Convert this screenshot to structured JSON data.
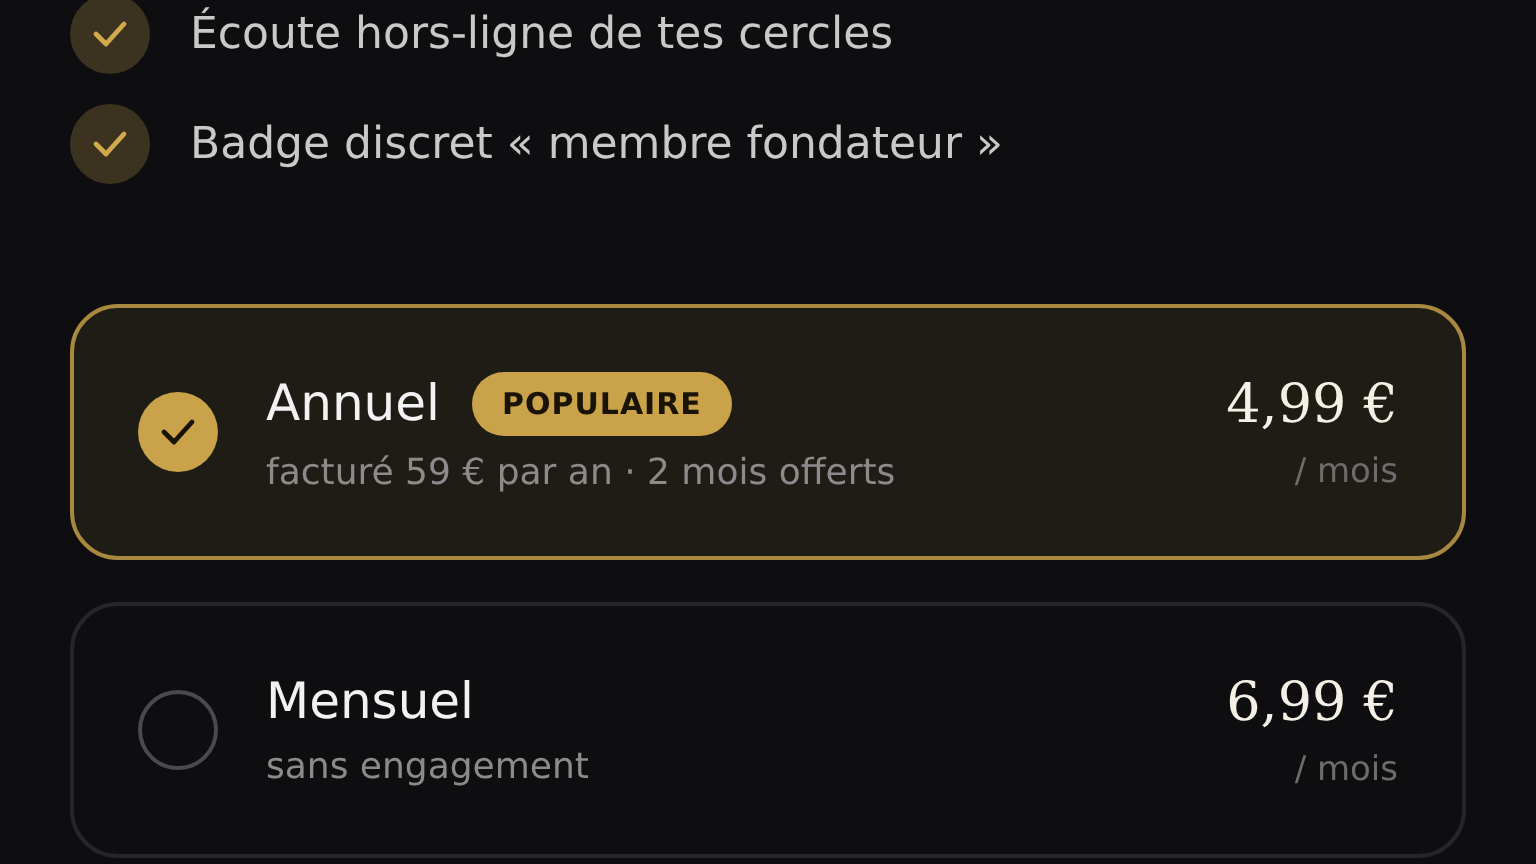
{
  "features": [
    {
      "label": "Écoute hors-ligne de tes cercles",
      "checked": true
    },
    {
      "label": "Badge discret « membre fondateur »",
      "checked": true
    }
  ],
  "plans": [
    {
      "name": "Annuel",
      "badge": "POPULAIRE",
      "subtitle": "facturé 59 € par an · 2 mois offerts",
      "price": "4,99 €",
      "unit": "/ mois",
      "selected": true
    },
    {
      "name": "Mensuel",
      "subtitle": "sans engagement",
      "price": "6,99 €",
      "unit": "/ mois",
      "selected": false
    }
  ]
}
